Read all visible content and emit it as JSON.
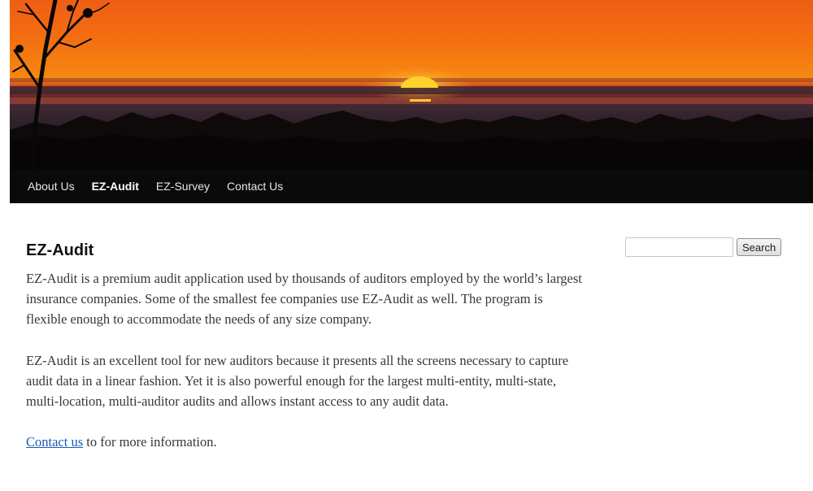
{
  "nav": {
    "items": [
      {
        "label": "About Us",
        "active": false
      },
      {
        "label": "EZ-Audit",
        "active": true
      },
      {
        "label": "EZ-Survey",
        "active": false
      },
      {
        "label": "Contact Us",
        "active": false
      }
    ]
  },
  "main": {
    "title": "EZ-Audit",
    "paragraph1": "EZ-Audit is a premium audit application used by thousands of auditors employed by the world’s largest insurance companies. Some of the smallest fee companies use EZ-Audit as well. The program is flexible enough to accommodate the needs of any size company.",
    "paragraph2": "EZ-Audit is an excellent tool for new auditors because it presents all the screens necessary to capture audit data in a linear fashion. Yet it is also powerful enough for the largest multi-entity, multi-state, multi-location, multi-auditor audits and allows instant access to any audit data.",
    "contact_link": "Contact us",
    "contact_suffix": " to for more information."
  },
  "search": {
    "placeholder": "",
    "value": "",
    "button_label": "Search"
  },
  "colors": {
    "nav_background": "#0a0a0a",
    "link": "#1b5bb5",
    "sky_orange": "#f26a12",
    "sun": "#ffd22e"
  }
}
